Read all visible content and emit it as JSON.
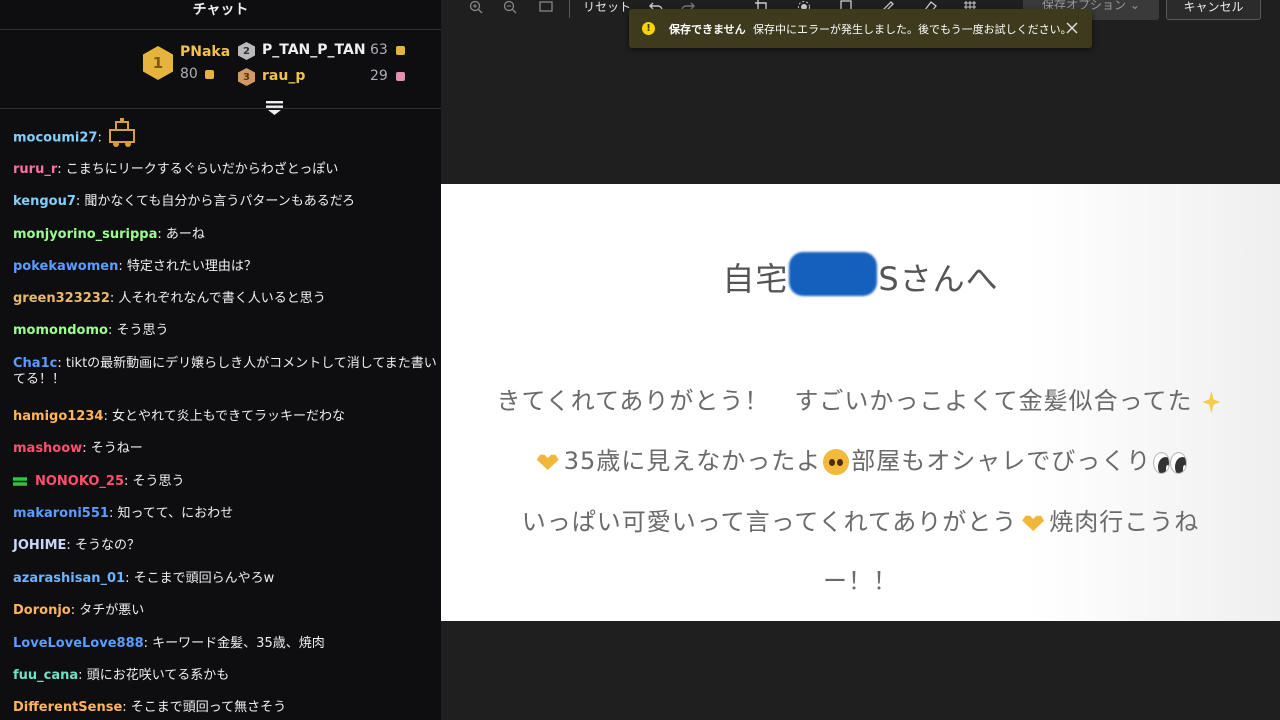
{
  "chat": {
    "title": "チャット",
    "leaderboard": {
      "first": {
        "rank": "1",
        "name": "PNaka",
        "score": "80"
      },
      "second": {
        "rank": "2",
        "name": "P_TAN_P_TAN",
        "score": "63"
      },
      "third": {
        "rank": "3",
        "name": "rau_p",
        "score": "29"
      }
    },
    "messages": [
      {
        "user": "mocoumi27",
        "text": "",
        "color": "#7fd0ff"
      },
      {
        "user": "ruru_r",
        "text": "こまちにリークするぐらいだからわざとっぽい",
        "color": "#ff6fa4"
      },
      {
        "user": "kengou7",
        "text": "聞かなくても自分から言うパターンもあるだろ",
        "color": "#7fd0ff"
      },
      {
        "user": "monjyorino_surippa",
        "text": "あーね",
        "color": "#9bff8f"
      },
      {
        "user": "pokekawomen",
        "text": "特定されたい理由は？",
        "color": "#5b9cff"
      },
      {
        "user": "green323232",
        "text": "人それぞれなんで書く人いると思う",
        "color": "#e8b86a"
      },
      {
        "user": "momondomo",
        "text": "そう思う",
        "color": "#9bff8f"
      },
      {
        "user": "Cha1c",
        "text": "tiktの最新動画にデリ嬢らしき人がコメントして消してまた書いてる！！",
        "color": "#5b9cff"
      },
      {
        "user": "hamigo1234",
        "text": "女とやれて炎上もできてラッキーだわな",
        "color": "#ffb45b"
      },
      {
        "user": "mashoow",
        "text": "そうねー",
        "color": "#ff4f6e"
      },
      {
        "user": "NONOKO_25",
        "text": "そう思う",
        "color": "#ff4f6e"
      },
      {
        "user": "makaroni551",
        "text": "知ってて、におわせ",
        "color": "#5b9cff"
      },
      {
        "user": "JOHIME",
        "text": "そうなの？",
        "color": "#c8d7ff"
      },
      {
        "user": "azarashisan_01",
        "text": "そこまで頭回らんやろw",
        "color": "#6fb3ff"
      },
      {
        "user": "Doronjo",
        "text": "タチが悪い",
        "color": "#ffb45b"
      },
      {
        "user": "LoveLoveLove888",
        "text": "キーワード金髪、35歳、焼肉",
        "color": "#5b9cff"
      },
      {
        "user": "fuu_cana",
        "text": "頭にお花咲いてる系かも",
        "color": "#6fe0c8"
      },
      {
        "user": "DifferentSense",
        "text": "そこまで頭回って無さそう",
        "color": "#ffb45b"
      }
    ]
  },
  "toolbar": {
    "reset_label": "リセット",
    "save_options_label": "保存オプション",
    "cancel_label": "キャンセル"
  },
  "toast": {
    "title": "保存できません",
    "message": "保存中にエラーが発生しました。後でもう一度お試しください。"
  },
  "image": {
    "heading_prefix": "自宅",
    "heading_suffix": "Sさんへ",
    "line1": "きてくれてありがとう！　すごいかっこよくて金髪似合ってた",
    "line2a": "35歳に見えなかったよ",
    "line2b": "部屋もオシャレでびっくり",
    "line3a": "いっぱい可愛いって言ってくれてありがとう",
    "line3b": "焼肉行こうね",
    "line4": "ー！！"
  }
}
